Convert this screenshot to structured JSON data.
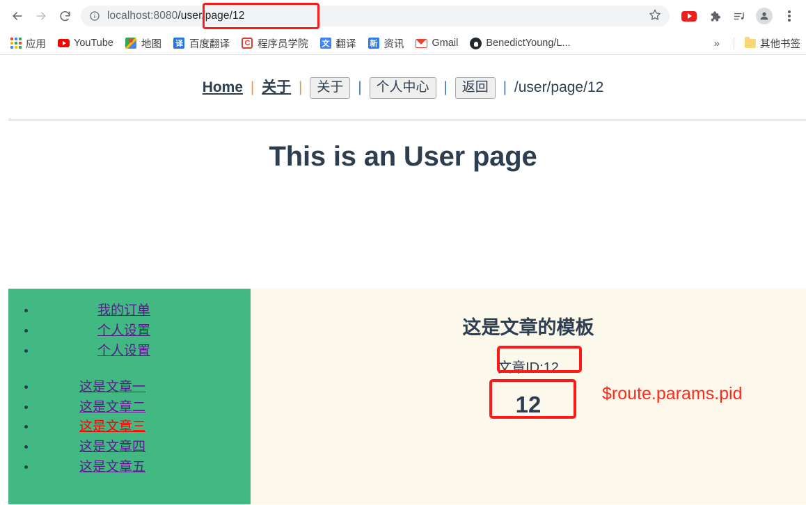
{
  "browser": {
    "back_icon": "back-arrow-icon",
    "forward_icon": "forward-arrow-icon",
    "reload_icon": "reload-icon",
    "omnibox": {
      "info_icon": "site-info-icon",
      "url_host": "localhost:8080",
      "url_path": "/user/page/12",
      "bookmark_icon": "star-icon"
    },
    "toolbar_icons": [
      "youtube-icon",
      "extensions-puzzle-icon",
      "media-playlist-icon",
      "profile-avatar-icon",
      "three-dot-menu-icon"
    ],
    "bookmarks": [
      {
        "label": "应用",
        "icon": "apps-grid-icon"
      },
      {
        "label": "YouTube",
        "icon": "youtube-icon"
      },
      {
        "label": "地图",
        "icon": "google-maps-icon"
      },
      {
        "label": "百度翻译",
        "icon": "baidu-translate-icon",
        "glyph": "译",
        "color": "#2475e8"
      },
      {
        "label": "程序员学院",
        "icon": "csdn-icon",
        "glyph": "C"
      },
      {
        "label": "翻译",
        "icon": "google-translate-icon",
        "glyph": "文",
        "color": "#4285f4"
      },
      {
        "label": "资讯",
        "icon": "google-news-icon",
        "glyph": "新",
        "color": "#2b7de9"
      },
      {
        "label": "Gmail",
        "icon": "gmail-icon"
      },
      {
        "label": "BenedictYoung/L...",
        "icon": "github-icon"
      }
    ],
    "overflow_label": "»",
    "other_bookmarks": {
      "label": "其他书签",
      "icon": "folder-icon"
    }
  },
  "page": {
    "nav": {
      "links": [
        {
          "label": "Home"
        },
        {
          "label": "关于"
        }
      ],
      "buttons": [
        {
          "label": "关于"
        },
        {
          "label": "个人中心"
        },
        {
          "label": "返回"
        }
      ],
      "separator": "|",
      "current_path": "/user/page/12"
    },
    "title": "This is an User page",
    "sidebar": {
      "group1": [
        {
          "label": "我的订单",
          "active": false
        },
        {
          "label": "个人设置",
          "active": false
        },
        {
          "label": "个人设置",
          "active": false
        }
      ],
      "group2": [
        {
          "label": "这是文章一",
          "active": false
        },
        {
          "label": "这是文章二",
          "active": false
        },
        {
          "label": "这是文章三",
          "active": true
        },
        {
          "label": "这是文章四",
          "active": false
        },
        {
          "label": "这是文章五",
          "active": false
        }
      ]
    },
    "content": {
      "title": "这是文章的模板",
      "article_id_text": "文章ID:12",
      "article_pid": "12",
      "annotation_text": "$route.params.pid"
    },
    "colors": {
      "sidebar_green": "#42b883",
      "content_cream": "#fdf8ec",
      "heading_navy": "#2c3e50",
      "annotation_red": "#ff1a1a",
      "link_purple": "#5b1a8b",
      "active_red": "#ff0000"
    }
  }
}
